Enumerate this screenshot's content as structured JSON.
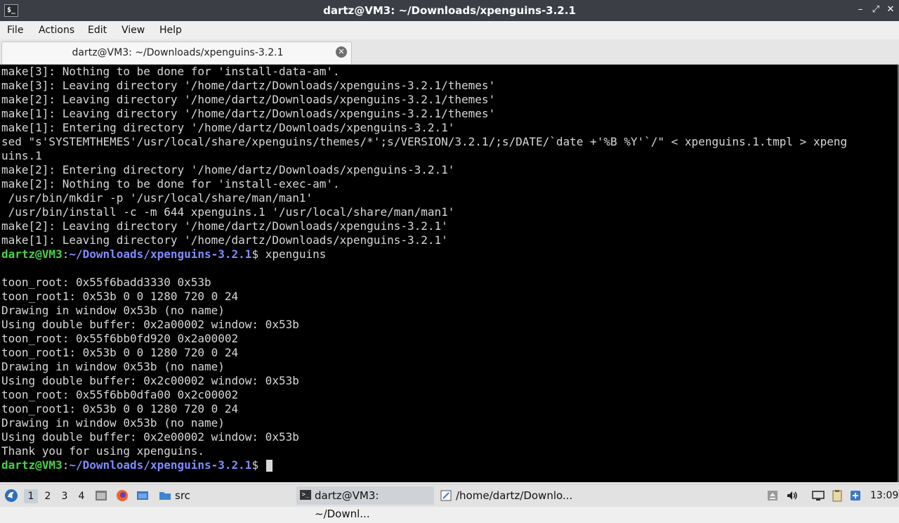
{
  "window": {
    "title": "dartz@VM3: ~/Downloads/xpenguins-3.2.1",
    "app_icon": "$_",
    "controls": [
      "–",
      "⤢",
      "✕"
    ]
  },
  "menu": [
    "File",
    "Actions",
    "Edit",
    "View",
    "Help"
  ],
  "tab": {
    "label": "dartz@VM3: ~/Downloads/xpenguins-3.2.1",
    "close": "✕"
  },
  "terminal": {
    "lines": [
      "make[3]: Nothing to be done for 'install-data-am'.",
      "make[3]: Leaving directory '/home/dartz/Downloads/xpenguins-3.2.1/themes'",
      "make[2]: Leaving directory '/home/dartz/Downloads/xpenguins-3.2.1/themes'",
      "make[1]: Leaving directory '/home/dartz/Downloads/xpenguins-3.2.1/themes'",
      "make[1]: Entering directory '/home/dartz/Downloads/xpenguins-3.2.1'",
      "sed \"s'SYSTEMTHEMES'/usr/local/share/xpenguins/themes/*';s/VERSION/3.2.1/;s/DATE/`date +'%B %Y'`/\" < xpenguins.1.tmpl > xpeng",
      "uins.1",
      "make[2]: Entering directory '/home/dartz/Downloads/xpenguins-3.2.1'",
      "make[2]: Nothing to be done for 'install-exec-am'.",
      " /usr/bin/mkdir -p '/usr/local/share/man/man1'",
      " /usr/bin/install -c -m 644 xpenguins.1 '/usr/local/share/man/man1'",
      "make[2]: Leaving directory '/home/dartz/Downloads/xpenguins-3.2.1'",
      "make[1]: Leaving directory '/home/dartz/Downloads/xpenguins-3.2.1'"
    ],
    "prompt_user": "dartz@VM3",
    "prompt_colon": ":",
    "prompt_path": "~/Downloads/xpenguins-3.2.1",
    "prompt_dollar": "$",
    "command": " xpenguins",
    "output": [
      "",
      "toon_root: 0x55f6badd3330 0x53b",
      "toon_root1: 0x53b 0 0 1280 720 0 24",
      "Drawing in window 0x53b (no name)",
      "Using double buffer: 0x2a00002 window: 0x53b",
      "toon_root: 0x55f6bb0fd920 0x2a00002",
      "toon_root1: 0x53b 0 0 1280 720 0 24",
      "Drawing in window 0x53b (no name)",
      "Using double buffer: 0x2c00002 window: 0x53b",
      "toon_root: 0x55f6bb0dfa00 0x2c00002",
      "toon_root1: 0x53b 0 0 1280 720 0 24",
      "Drawing in window 0x53b (no name)",
      "Using double buffer: 0x2e00002 window: 0x53b",
      "Thank you for using xpenguins."
    ]
  },
  "taskbar": {
    "desktops": [
      "1",
      "2",
      "3",
      "4"
    ],
    "folder_label": "src",
    "tasks": [
      "dartz@VM3: ~/Downl...",
      "/home/dartz/Downlo..."
    ],
    "clock": "13:09"
  }
}
